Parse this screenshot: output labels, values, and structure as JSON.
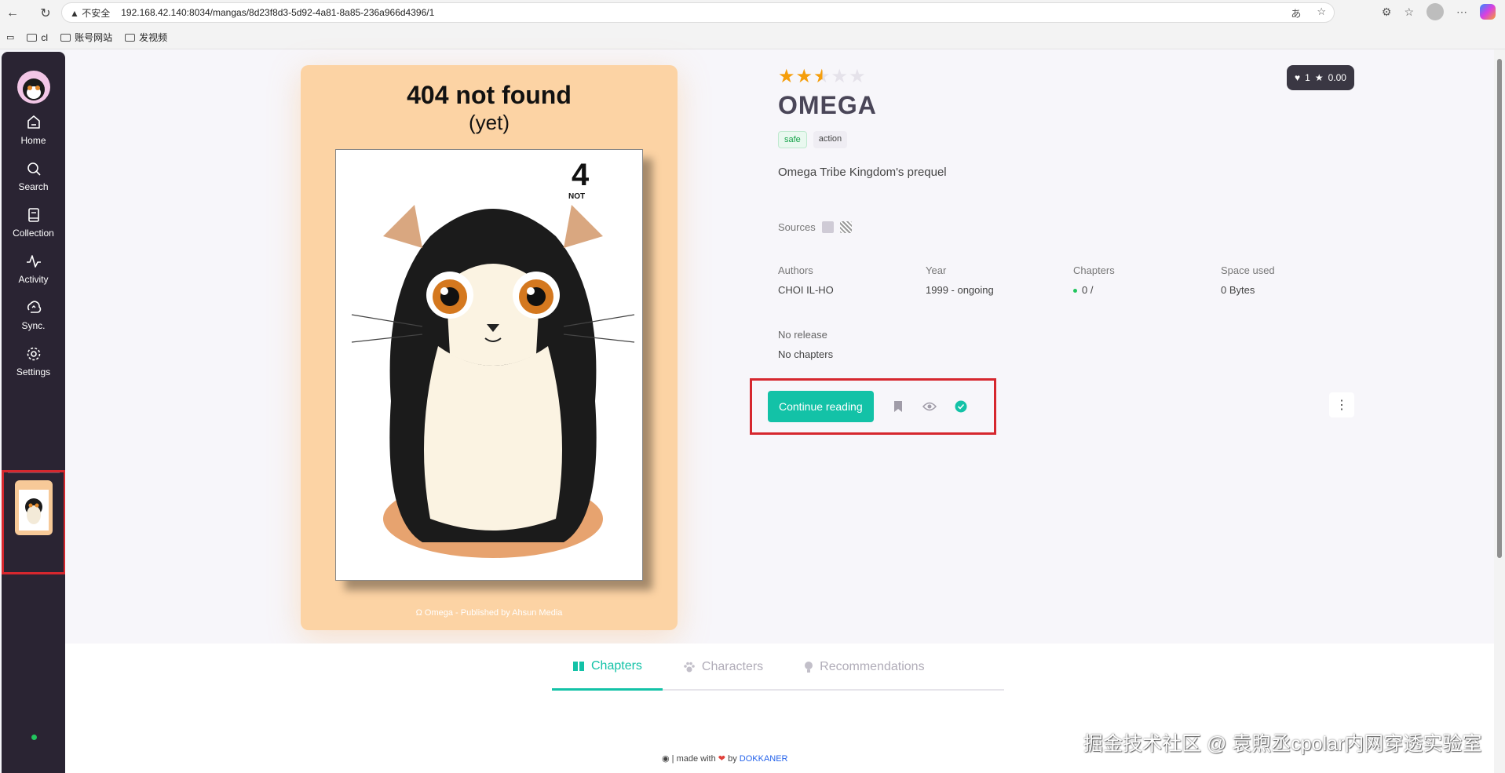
{
  "browser": {
    "security_label": "不安全",
    "url": "192.168.42.140:8034/mangas/8d23f8d3-5d92-4a81-8a85-236a966d4396/1",
    "bookmarks": [
      "cl",
      "账号网站",
      "发视频"
    ]
  },
  "sidebar": {
    "items": [
      {
        "label": "Home",
        "icon": "home-icon"
      },
      {
        "label": "Search",
        "icon": "search-icon"
      },
      {
        "label": "Collection",
        "icon": "book-icon"
      },
      {
        "label": "Activity",
        "icon": "activity-icon"
      },
      {
        "label": "Sync.",
        "icon": "sync-icon"
      },
      {
        "label": "Settings",
        "icon": "gear-icon"
      }
    ]
  },
  "cover": {
    "title": "404 not found",
    "subtitle": "(yet)",
    "credit": "Ω Omega - Published by Ahsun Media"
  },
  "manga": {
    "rating_stars": 2.5,
    "title": "OMEGA",
    "tags": [
      "safe",
      "action"
    ],
    "description": "Omega Tribe Kingdom's prequel",
    "sources_label": "Sources",
    "meta": [
      {
        "label": "Authors",
        "value": "CHOI IL-HO"
      },
      {
        "label": "Year",
        "value": "1999 - ongoing"
      },
      {
        "label": "Chapters",
        "value": "0 /"
      },
      {
        "label": "Space used",
        "value": "0 Bytes"
      }
    ],
    "release_label": "No release",
    "chapters_label": "No chapters",
    "continue_label": "Continue reading",
    "fav_count": "1",
    "score": "0.00"
  },
  "tabs": [
    "Chapters",
    "Characters",
    "Recommendations"
  ],
  "footer": {
    "text": "| made with",
    "by": "by",
    "author": "DOKKANER"
  },
  "watermark": "掘金技术社区 @ 袁煦丞cpolar内网穿透实验室",
  "colors": {
    "accent": "#13c2a7",
    "sidebar_bg": "#2a2433",
    "highlight": "#d6272e"
  }
}
